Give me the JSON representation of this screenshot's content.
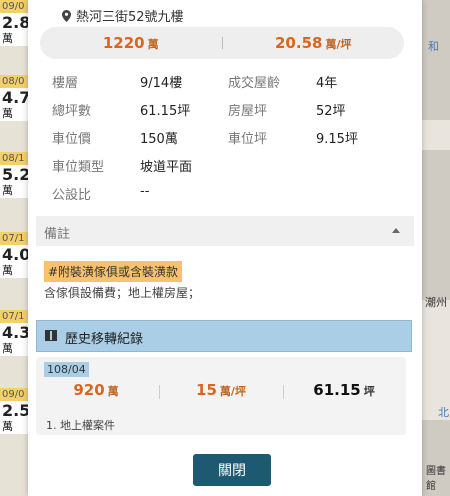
{
  "strip": [
    {
      "date": "09/0",
      "price": "2.8",
      "unit": "萬"
    },
    {
      "date": "08/0",
      "price": "4.7",
      "unit": "萬"
    },
    {
      "date": "08/1",
      "price": "5.2",
      "unit": "萬"
    },
    {
      "date": "07/1",
      "price": "4.0",
      "unit": "萬"
    },
    {
      "date": "07/1",
      "price": "4.3",
      "unit": "萬"
    },
    {
      "date": "09/0",
      "price": "2.5",
      "unit": "萬"
    }
  ],
  "map": {
    "label1": "和",
    "label2": "潮州",
    "label3": "北",
    "label4": "圖書館"
  },
  "address": "熱河三街52號九樓",
  "price_total": "1220",
  "price_total_unit": "萬",
  "price_per": "20.58",
  "price_per_unit": "萬/坪",
  "details": [
    {
      "l1": "樓層",
      "v1": "9/14樓",
      "l2": "成交屋齡",
      "v2": "4年"
    },
    {
      "l1": "總坪數",
      "v1": "61.15坪",
      "l2": "房屋坪",
      "v2": "52坪"
    },
    {
      "l1": "車位價",
      "v1": "150萬",
      "l2": "車位坪",
      "v2": "9.15坪"
    },
    {
      "l1": "車位類型",
      "v1": "坡道平面",
      "l2": "",
      "v2": ""
    },
    {
      "l1": "公設比",
      "v1": "--",
      "l2": "",
      "v2": ""
    }
  ],
  "remark_label": "備註",
  "remark_tag": "#附裝潢傢俱或含裝潢款",
  "remark_note": "含傢俱設備費；地上權房屋；",
  "history_title": "歷史移轉紀錄",
  "history": {
    "date": "108/04",
    "total": "920",
    "total_unit": "萬",
    "per": "15",
    "per_unit": "萬/坪",
    "area": "61.15",
    "area_unit": "坪",
    "note": "1. 地上權案件"
  },
  "close_label": "關閉"
}
